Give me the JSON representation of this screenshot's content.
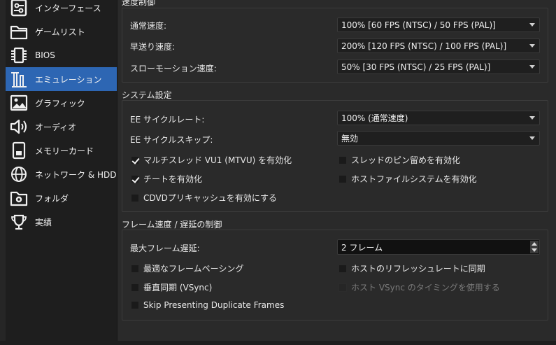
{
  "sidebar": {
    "items": [
      {
        "label": "インターフェース",
        "icon": "interface-icon",
        "active": false
      },
      {
        "label": "ゲームリスト",
        "icon": "folder-icon",
        "active": false
      },
      {
        "label": "BIOS",
        "icon": "chip-icon",
        "active": false
      },
      {
        "label": "エミュレーション",
        "icon": "emulation-icon",
        "active": true
      },
      {
        "label": "グラフィック",
        "icon": "image-icon",
        "active": false
      },
      {
        "label": "オーディオ",
        "icon": "speaker-icon",
        "active": false
      },
      {
        "label": "メモリーカード",
        "icon": "memory-card-icon",
        "active": false
      },
      {
        "label": "ネットワーク & HDD",
        "icon": "globe-icon",
        "active": false
      },
      {
        "label": "フォルダ",
        "icon": "folder-gear-icon",
        "active": false
      },
      {
        "label": "実績",
        "icon": "trophy-icon",
        "active": false
      }
    ],
    "active_color": "#2d66b3"
  },
  "speed": {
    "title": "速度制御",
    "normal_label": "通常速度:",
    "normal_value": "100% [60 FPS (NTSC) / 50 FPS (PAL)]",
    "fast_label": "早送り速度:",
    "fast_value": "200% [120 FPS (NTSC) / 100 FPS (PAL)]",
    "slow_label": "スローモーション速度:",
    "slow_value": "50% [30 FPS (NTSC) / 25 FPS (PAL)]"
  },
  "system": {
    "title": "システム設定",
    "ee_rate_label": "EE サイクルレート:",
    "ee_rate_value": "100% (通常速度)",
    "ee_skip_label": "EE サイクルスキップ:",
    "ee_skip_value": "無効",
    "mtvu": {
      "label": "マルチスレッド VU1 (MTVU) を有効化",
      "checked": true
    },
    "pinning": {
      "label": "スレッドのピン留めを有効化",
      "checked": false
    },
    "cheats": {
      "label": "チートを有効化",
      "checked": true
    },
    "host_fs": {
      "label": "ホストファイルシステムを有効化",
      "checked": false
    },
    "cdvd": {
      "label": "CDVDプリキャッシュを有効にする",
      "checked": false
    }
  },
  "frame": {
    "title": "フレーム速度 / 遅延の制御",
    "max_delay_label": "最大フレーム遅延:",
    "max_delay_value": "2 フレーム",
    "optimal_pacing": {
      "label": "最適なフレームペーシング",
      "checked": false
    },
    "sync_refresh": {
      "label": "ホストのリフレッシュレートに同期",
      "checked": false
    },
    "vsync": {
      "label": "垂直同期 (VSync)",
      "checked": false
    },
    "host_vsync": {
      "label": "ホスト VSync のタイミングを使用する",
      "checked": false,
      "disabled": true
    },
    "skip_dup": {
      "label": "Skip Presenting Duplicate Frames",
      "checked": false
    }
  }
}
